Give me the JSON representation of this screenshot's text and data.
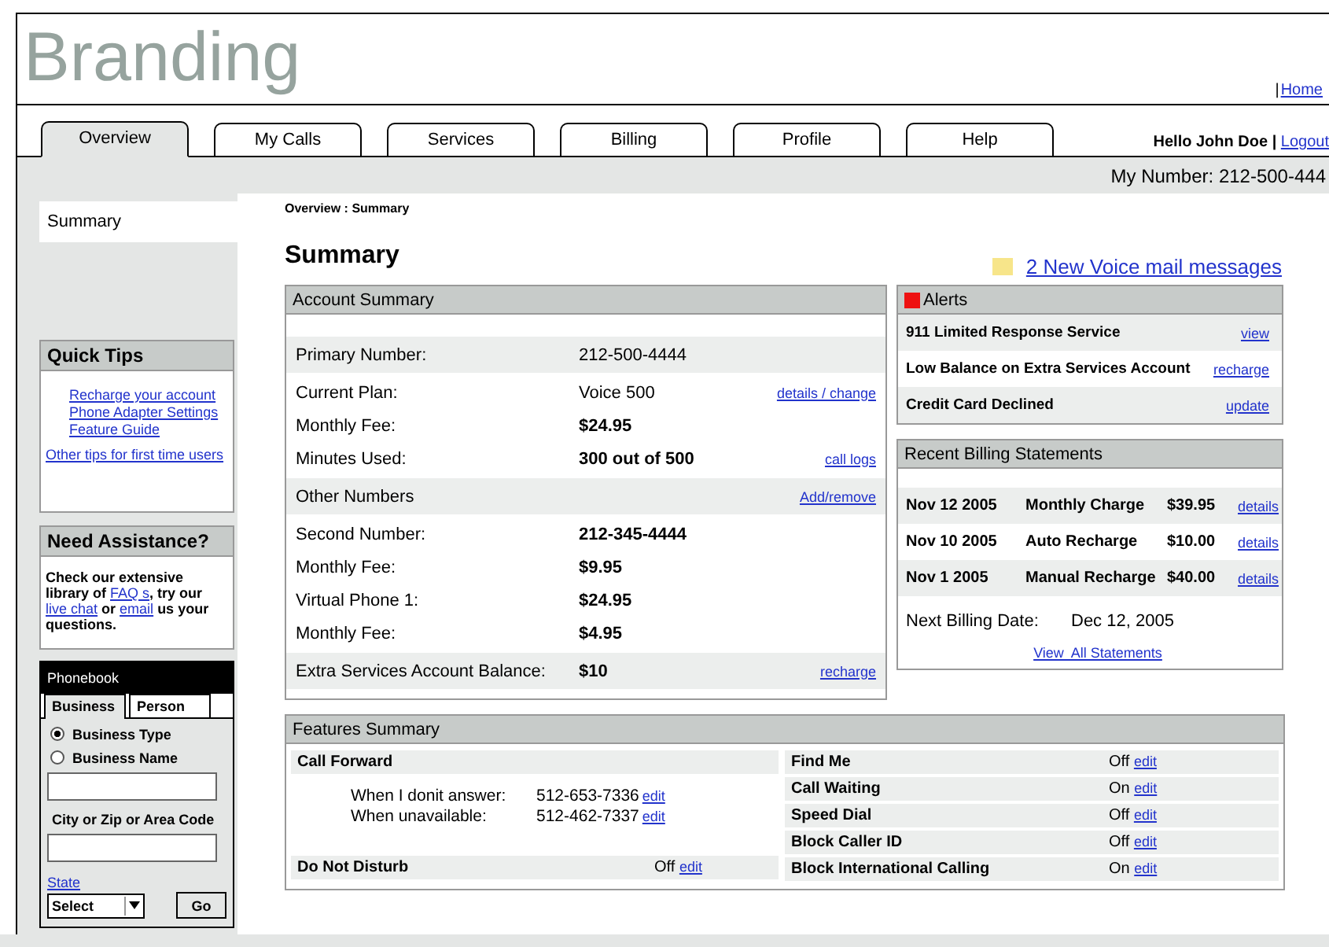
{
  "brand": "Branding",
  "header_links": {
    "separator": "|",
    "home": "Home"
  },
  "tabs": [
    {
      "label": "Overview",
      "selected": true
    },
    {
      "label": "My Calls",
      "selected": false
    },
    {
      "label": "Services",
      "selected": false
    },
    {
      "label": "Billing",
      "selected": false
    },
    {
      "label": "Profile",
      "selected": false
    },
    {
      "label": "Help",
      "selected": false
    }
  ],
  "greeting": "Hello John Doe |",
  "logout": "Logout",
  "my_number": "My Number: 212-500-444",
  "sidebar": {
    "nav": [
      {
        "label": "Summary",
        "selected": true
      }
    ],
    "quick_tips": {
      "title": "Quick Tips",
      "links": [
        "Recharge your account",
        "Phone Adapter Settings",
        "Feature Guide"
      ],
      "other_link": "Other tips for first time users"
    },
    "assistance": {
      "title": "Need Assistance?",
      "parts": [
        {
          "text": "Check our extensive library of ",
          "link": false
        },
        {
          "text": "FAQ s",
          "link": true
        },
        {
          "text": ", try our ",
          "link": false
        },
        {
          "text": "live chat",
          "link": true
        },
        {
          "text": " or ",
          "link": false
        },
        {
          "text": "email",
          "link": true
        },
        {
          "text": " us your questions.",
          "link": false
        }
      ]
    },
    "phonebook": {
      "title": "Phonebook",
      "tabs": [
        {
          "label": "Business",
          "selected": true
        },
        {
          "label": "Person",
          "selected": false
        }
      ],
      "radios": [
        {
          "label": "Business Type",
          "selected": true
        },
        {
          "label": "Business Name",
          "selected": false
        }
      ],
      "city_label": "City or Zip or Area Code",
      "state_link": "State",
      "select": "Select",
      "go": "Go"
    }
  },
  "breadcrumb": "Overview : Summary",
  "page_title": "Summary",
  "voicemail": "2 New Voice mail messages",
  "account_summary": {
    "title": "Account Summary",
    "rows": [
      {
        "kind": "row",
        "label": "Primary Number:",
        "value": "212-500-4444",
        "bold": false,
        "shaded": true
      },
      {
        "kind": "row",
        "label": "Current Plan:",
        "value": "Voice 500",
        "bold": false,
        "link": "details / change",
        "shaded": false
      },
      {
        "kind": "row",
        "label": "Monthly Fee:",
        "value": "$24.95",
        "bold": true,
        "shaded": false
      },
      {
        "kind": "row",
        "label": "Minutes Used:",
        "value": "300 out of 500",
        "bold": true,
        "link": "call logs",
        "shaded": false
      },
      {
        "kind": "section",
        "label": "Other Numbers",
        "link": "Add/remove"
      },
      {
        "kind": "row",
        "label": "Second Number:",
        "value": "212-345-4444",
        "bold": true,
        "shaded": false
      },
      {
        "kind": "row",
        "label": "Monthly Fee:",
        "value": "$9.95",
        "bold": true,
        "shaded": false
      },
      {
        "kind": "row",
        "label": "Virtual Phone 1:",
        "value": "$24.95",
        "bold": true,
        "shaded": false
      },
      {
        "kind": "row",
        "label": "Monthly Fee:",
        "value": "$4.95",
        "bold": true,
        "shaded": false
      },
      {
        "kind": "row",
        "label": "Extra Services Account Balance:",
        "value": "$10",
        "bold": true,
        "link": "recharge",
        "shaded": true
      }
    ]
  },
  "alerts": {
    "title": "Alerts",
    "color": "#ee1111",
    "items": [
      {
        "text": "911 Limited Response Service",
        "link": "view"
      },
      {
        "text": "Low Balance on Extra Services Account",
        "link": "recharge"
      },
      {
        "text": "Credit Card Declined",
        "link": "update"
      }
    ]
  },
  "billing": {
    "title": "Recent Billing Statements",
    "rows": [
      {
        "date": "Nov 12 2005",
        "type": "Monthly Charge",
        "amount": "$39.95",
        "link": "details"
      },
      {
        "date": "Nov 10 2005",
        "type": "Auto Recharge",
        "amount": "$10.00",
        "link": "details"
      },
      {
        "date": "Nov 1 2005",
        "type": "Manual Recharge",
        "amount": "$40.00",
        "link": "details"
      }
    ],
    "next_label": "Next Billing Date:",
    "next_date": "Dec 12, 2005",
    "all_link": "View  All Statements"
  },
  "features": {
    "title": "Features Summary",
    "call_forward": {
      "title": "Call Forward",
      "rows": [
        {
          "label": "When I donit answer:",
          "value": "512-653-7336",
          "link": "edit"
        },
        {
          "label": "When unavailable:",
          "value": "512-462-7337",
          "link": "edit"
        }
      ]
    },
    "dnd": {
      "label": "Do Not Disturb",
      "status": "Off",
      "link": "edit"
    },
    "right": [
      {
        "label": "Find Me",
        "status": "Off",
        "link": "edit"
      },
      {
        "label": "Call Waiting",
        "status": "On",
        "link": "edit"
      },
      {
        "label": "Speed Dial",
        "status": "Off",
        "link": "edit"
      },
      {
        "label": "Block Caller ID",
        "status": "Off",
        "link": "edit"
      },
      {
        "label": "Block International Calling",
        "status": "On",
        "link": "edit"
      }
    ]
  }
}
